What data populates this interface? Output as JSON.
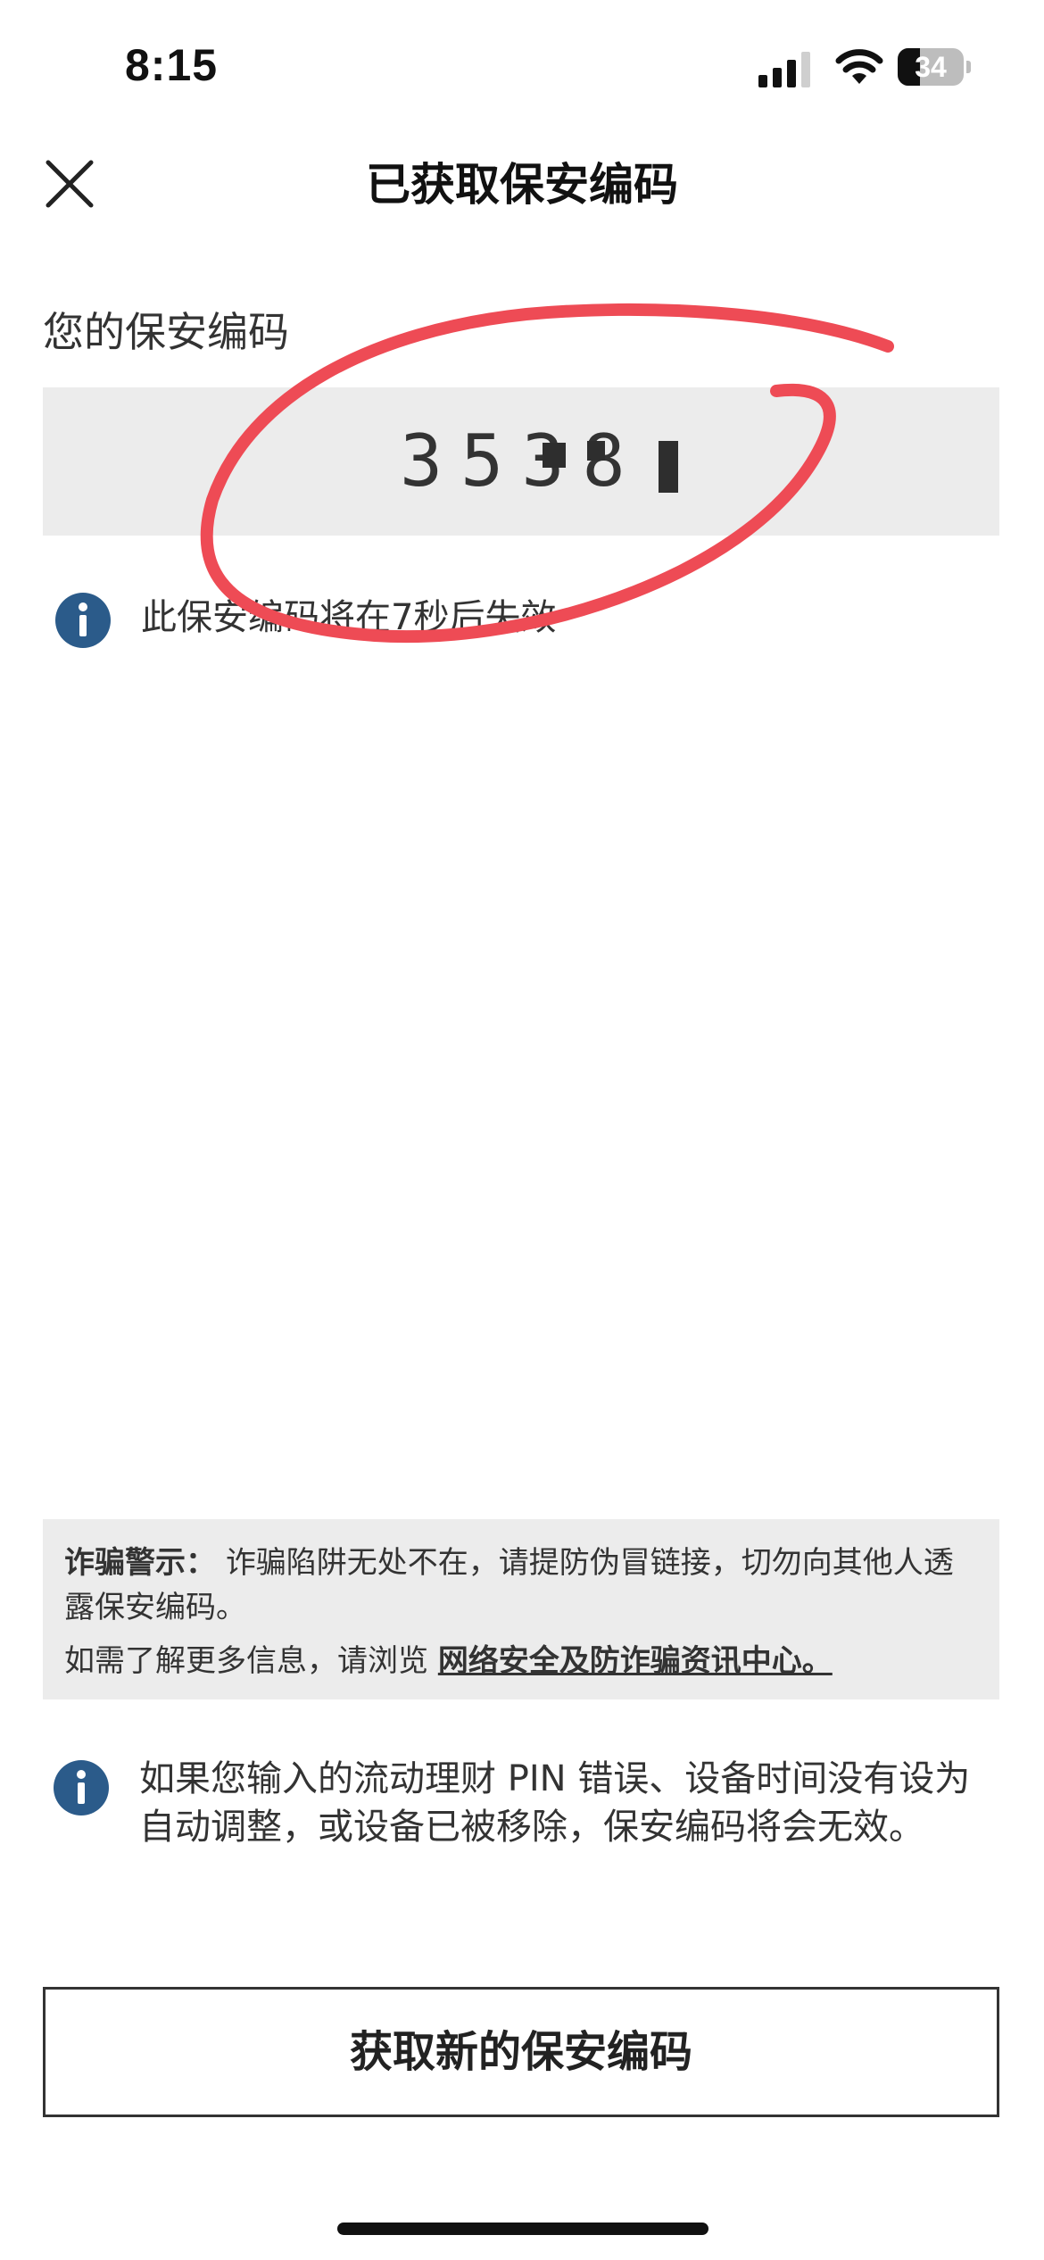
{
  "status_bar": {
    "time": "8:15",
    "battery_level": "34",
    "battery_fraction": 0.34,
    "icons": [
      "signal-icon",
      "wifi-icon",
      "battery-icon"
    ]
  },
  "header": {
    "title": "已获取保安编码",
    "close_icon": "close-icon"
  },
  "security_code": {
    "label": "您的保安编码",
    "value_visible": "3538"
  },
  "expiry_notice": {
    "icon": "info-icon",
    "text": "此保安编码将在7秒后失效"
  },
  "fraud_warning": {
    "title": "诈骗警示：",
    "body": "诈骗陷阱无处不在，请提防伪冒链接，切勿向其他人透露保安编码。",
    "more_info_prefix": "如需了解更多信息，请浏览",
    "link_text": "网络安全及防诈骗资讯中心。"
  },
  "invalid_notice": {
    "icon": "info-icon",
    "text": "如果您输入的流动理财 PIN 错误、设备时间没有设为自动调整，或设备已被移除，保安编码将会无效。"
  },
  "actions": {
    "new_code_button": "获取新的保安编码"
  },
  "colors": {
    "accent_blue": "#2b5b8a",
    "annotation_red": "#ee4b55",
    "panel_gray": "#ececec"
  }
}
